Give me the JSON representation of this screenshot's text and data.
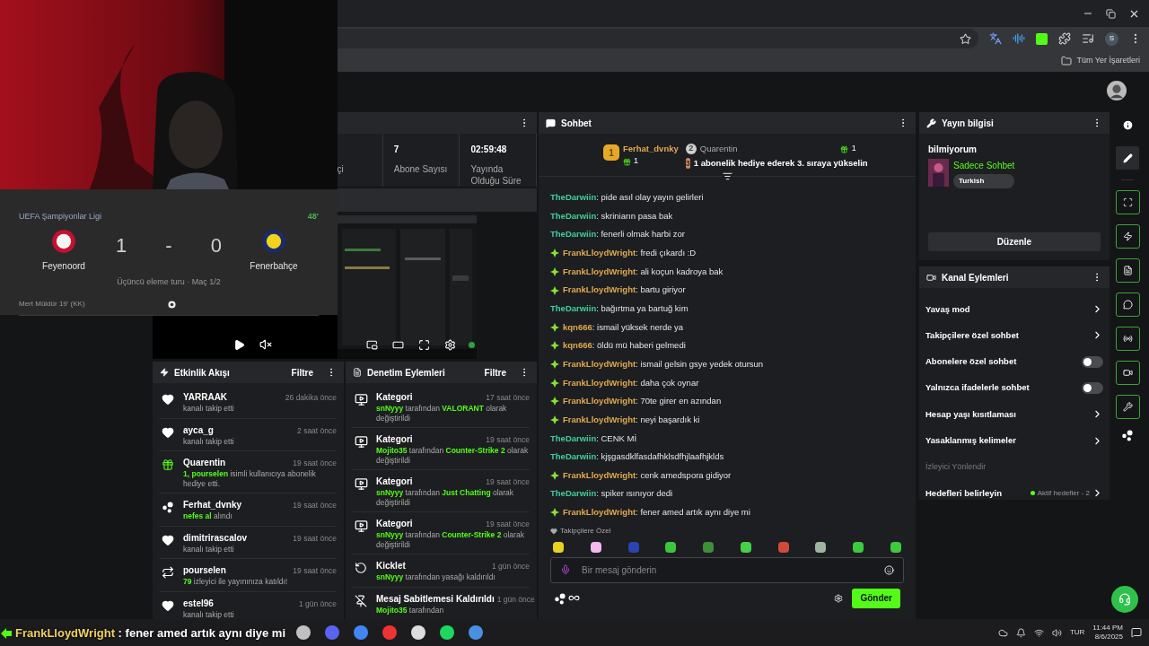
{
  "browser": {
    "bookmarks_label": "Tüm Yer İşaretleri",
    "profile_initial": "S"
  },
  "scoreboard": {
    "competition": "UEFA Şampiyonlar Ligi",
    "minute": "48'",
    "home": {
      "name": "Feyenoord",
      "score": "1"
    },
    "separator": "-",
    "away": {
      "name": "Fenerbahçe",
      "score": "0"
    },
    "round": "Üçüncü eleme turu · Maç 1/2",
    "event": "Mert Müldür 19' (KK)"
  },
  "stats": [
    {
      "label": "çi"
    },
    {
      "value": "7",
      "label": "Abone Sayısı"
    },
    {
      "value": "02:59:48",
      "label": "Yayında Olduğu Süre"
    }
  ],
  "activity_feed": {
    "title": "Etkinlik Akışı",
    "filter": "Filtre",
    "items": [
      {
        "kind": "follow",
        "user": "YARRAAK",
        "time": "26 dakika önce",
        "text": "kanalı takip etti"
      },
      {
        "kind": "follow",
        "user": "ayca_g",
        "time": "2 saat önce",
        "text": "kanalı takip etti"
      },
      {
        "kind": "gift",
        "user": "Quarentin",
        "time": "19 saat önce",
        "text": "**1, pourselen** isimli kullanıcıya abonelik hediye etti."
      },
      {
        "kind": "reward",
        "user": "Ferhat_dvnky",
        "time": "19 saat önce",
        "text": "**nefes al** alındı"
      },
      {
        "kind": "follow",
        "user": "dimitrirascalov",
        "time": "19 saat önce",
        "text": "kanalı takip etti"
      },
      {
        "kind": "raid",
        "user": "pourselen",
        "time": "19 saat önce",
        "text": "**79** izleyici ile yayınınıza katıldı!"
      },
      {
        "kind": "follow",
        "user": "estel96",
        "time": "1 gün önce",
        "text": "kanalı takip etti"
      }
    ]
  },
  "moderation": {
    "title": "Denetim Eylemleri",
    "filter": "Filtre",
    "items": [
      {
        "kind": "category",
        "title": "Kategori",
        "time": "17 saat önce",
        "text": "**snNyyy** tarafından **VALORANT** olarak değiştirildi"
      },
      {
        "kind": "category",
        "title": "Kategori",
        "time": "19 saat önce",
        "text": "**Mojito35** tarafından **Counter-Strike 2** olarak değiştirildi"
      },
      {
        "kind": "category",
        "title": "Kategori",
        "time": "19 saat önce",
        "text": "**snNyyy** tarafından **Just Chatting** olarak değiştirildi"
      },
      {
        "kind": "category",
        "title": "Kategori",
        "time": "19 saat önce",
        "text": "**snNyyy** tarafından **Counter-Strike 2** olarak değiştirildi"
      },
      {
        "kind": "unban",
        "title": "Kicklet",
        "time": "1 gün önce",
        "text": "**snNyyy** tarafından yasağı kaldırıldı"
      },
      {
        "kind": "unpin",
        "title": "Mesaj Sabitlemesi Kaldırıldı",
        "time": "1 gün önce",
        "text": "**Mojito35** tarafından"
      }
    ]
  },
  "chat": {
    "title": "Sohbet",
    "leaderboard": [
      {
        "rank": "1",
        "name": "Ferhat_dvnky",
        "count": "1"
      },
      {
        "rank": "2",
        "name": "Quarentin",
        "count": "1"
      },
      {
        "rank": "3",
        "text": "1 abonelik hediye ederek 3. sıraya yükselin"
      }
    ],
    "messages": [
      {
        "user": "TheDarwiin",
        "color": "#3fcf9b",
        "badge": false,
        "text": "pide asıl olay yayın gelirleri"
      },
      {
        "user": "TheDarwiin",
        "color": "#3fcf9b",
        "badge": false,
        "text": "skriniarın pasa bak"
      },
      {
        "user": "TheDarwiin",
        "color": "#3fcf9b",
        "badge": false,
        "text": "fenerli olmak harbi zor"
      },
      {
        "user": "FrankLloydWright",
        "color": "#e0a94e",
        "badge": true,
        "text": "fredi çıkardı :D"
      },
      {
        "user": "FrankLloydWright",
        "color": "#e0a94e",
        "badge": true,
        "text": "ali koçun kadroya bak"
      },
      {
        "user": "FrankLloydWright",
        "color": "#e0a94e",
        "badge": true,
        "text": "bartu giriyor"
      },
      {
        "user": "TheDarwiin",
        "color": "#3fcf9b",
        "badge": false,
        "text": "bağırtma ya bartuğ kim"
      },
      {
        "user": "kqn666",
        "color": "#e0a94e",
        "badge": true,
        "text": "ismail yüksek nerde ya"
      },
      {
        "user": "kqn666",
        "color": "#e0a94e",
        "badge": true,
        "text": "öldü mü haberi gelmedi"
      },
      {
        "user": "FrankLloydWright",
        "color": "#e0a94e",
        "badge": true,
        "text": "ismail gelsin gsye yedek otursun"
      },
      {
        "user": "FrankLloydWright",
        "color": "#e0a94e",
        "badge": true,
        "text": "daha çok oynar"
      },
      {
        "user": "FrankLloydWright",
        "color": "#e0a94e",
        "badge": true,
        "text": "70te girer en azından"
      },
      {
        "user": "FrankLloydWright",
        "color": "#e0a94e",
        "badge": true,
        "text": "neyi başardık ki"
      },
      {
        "user": "TheDarwiin",
        "color": "#3fcf9b",
        "badge": false,
        "text": "CENK Mİ"
      },
      {
        "user": "TheDarwiin",
        "color": "#3fcf9b",
        "badge": false,
        "text": "kjşgasdklfasdafhklsdfhjlaafhjklds"
      },
      {
        "user": "FrankLloydWright",
        "color": "#e0a94e",
        "badge": true,
        "text": "cenk amedspora gidiyor"
      },
      {
        "user": "TheDarwiin",
        "color": "#3fcf9b",
        "badge": false,
        "text": "spiker ısınıyor dedi"
      },
      {
        "user": "FrankLloydWright",
        "color": "#e0a94e",
        "badge": true,
        "text": "fener amed artık aynı diye mi"
      }
    ],
    "followers_label": "Takipçilere Özel",
    "emotes": [
      {
        "color": "#e8d21f"
      },
      {
        "color": "#f2b8ef"
      },
      {
        "color": "#2c43b0"
      },
      {
        "color": "#3cc63c"
      },
      {
        "color": "#3f8e3b"
      },
      {
        "color": "#47d047"
      },
      {
        "color": "#d44a3a"
      },
      {
        "color": "#9fb59f"
      },
      {
        "color": "#3fc93f"
      },
      {
        "color": "#3fc93f"
      }
    ],
    "name_separator": ":",
    "input_placeholder": "Bir mesaj gönderin",
    "send": "Gönder"
  },
  "stream_info": {
    "title": "Yayın bilgisi",
    "stream_title": "bilmiyorum",
    "category": "Sadece Sohbet",
    "tag": "Turkish",
    "edit": "Düzenle"
  },
  "channel_actions": {
    "title": "Kanal Eylemleri",
    "items": [
      {
        "kind": "link",
        "label": "Yavaş mod"
      },
      {
        "kind": "link",
        "label": "Takipçilere özel sohbet"
      },
      {
        "kind": "toggle",
        "label": "Abonelere özel sohbet",
        "on": false
      },
      {
        "kind": "toggle",
        "label": "Yalnızca ifadelerle sohbet",
        "on": false
      },
      {
        "kind": "link",
        "label": "Hesap yaşı kısıtlaması"
      },
      {
        "kind": "link",
        "label": "Yasaklanmış kelimeler"
      },
      {
        "kind": "section",
        "label": "İzleyici Yönlendir"
      },
      {
        "kind": "goal",
        "label": "Hedefleri belirleyin",
        "status": "Aktif hedefler - 2"
      }
    ]
  },
  "overlay": {
    "user": "FrankLloydWright",
    "separator": ":",
    "text": "fener amed artık aynı diye mi"
  },
  "taskbar": {
    "language": "TUR",
    "time": "11:44 PM",
    "date": "8/6/2025"
  }
}
